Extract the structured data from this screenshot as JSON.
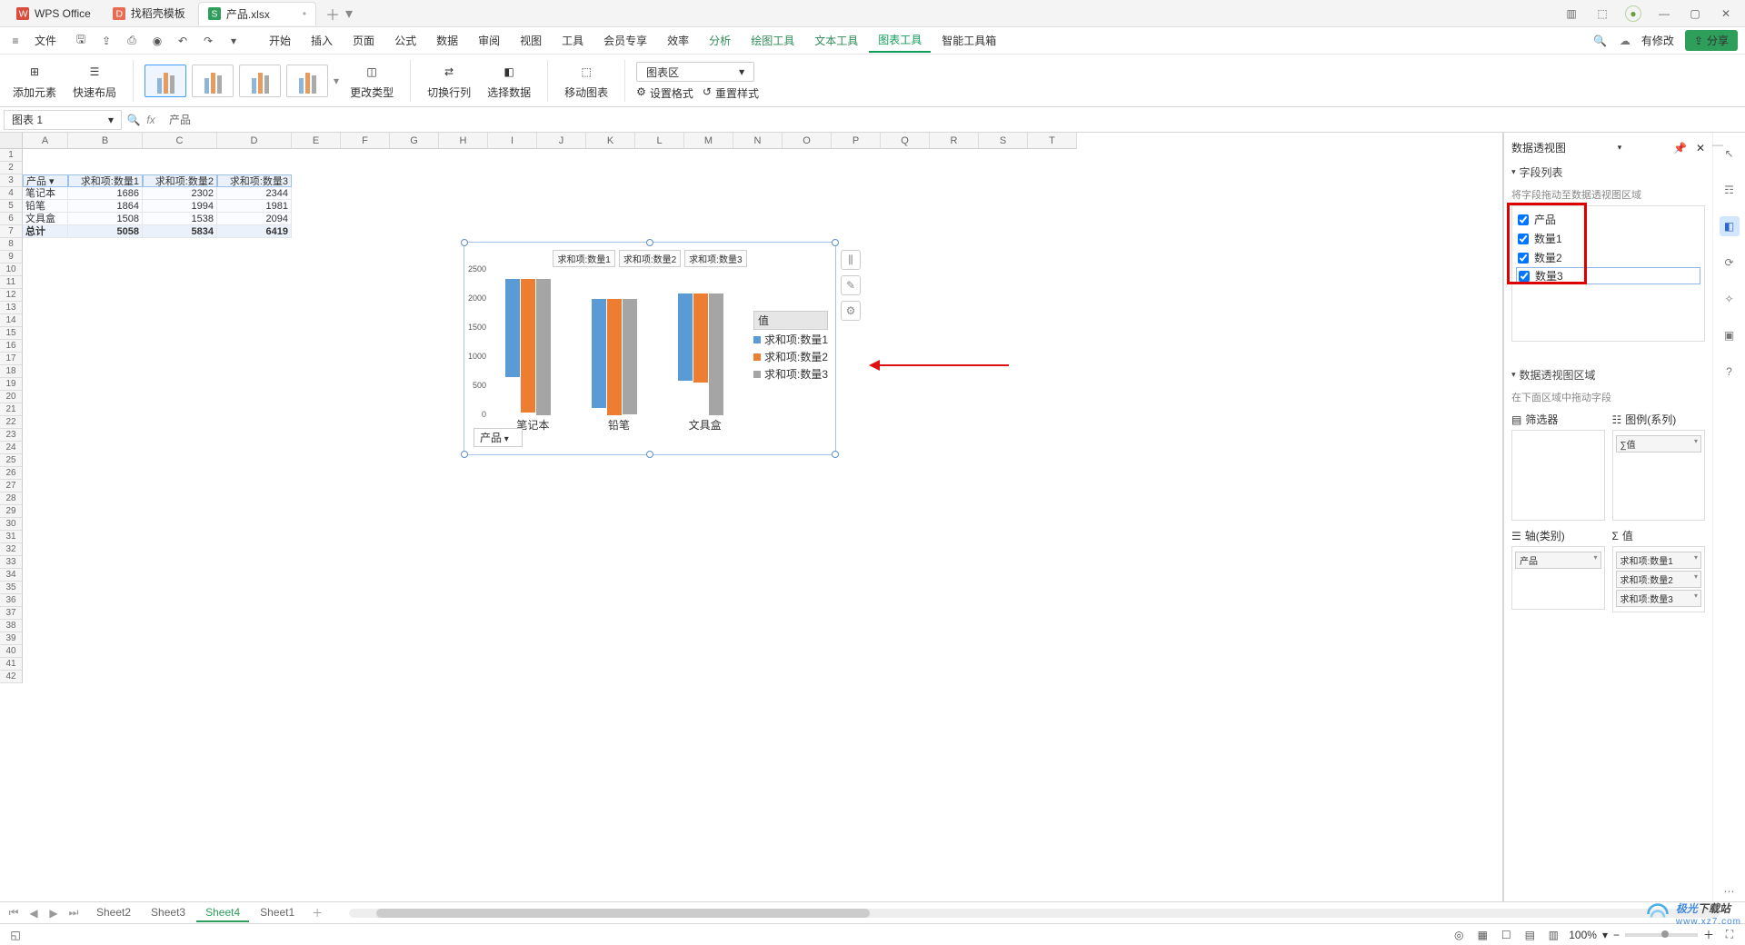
{
  "tabs": {
    "app": "WPS Office",
    "find": "找稻壳模板",
    "file": "产品.xlsx"
  },
  "menu": {
    "file": "文件",
    "items": [
      "开始",
      "插入",
      "页面",
      "公式",
      "数据",
      "审阅",
      "视图",
      "工具",
      "会员专享",
      "效率",
      "分析",
      "绘图工具",
      "文本工具",
      "图表工具",
      "智能工具箱"
    ],
    "has_changes": "有修改",
    "share": "分享"
  },
  "ribbon": {
    "add_elem": "添加元素",
    "quick_layout": "快速布局",
    "change_type": "更改类型",
    "switch_rc": "切换行列",
    "select_data": "选择数据",
    "move_chart": "移动图表",
    "set_format": "设置格式",
    "reset_style": "重置样式",
    "chart_area": "图表区"
  },
  "formula": {
    "name": "图表 1",
    "val": "产品"
  },
  "columns": [
    "A",
    "B",
    "C",
    "D",
    "E",
    "F",
    "G",
    "H",
    "I",
    "J",
    "K",
    "L",
    "M",
    "N",
    "O",
    "P",
    "Q",
    "R",
    "S",
    "T"
  ],
  "pivot": {
    "header": [
      "产品",
      "求和项:数量1",
      "求和项:数量2",
      "求和项:数量3"
    ],
    "rows": [
      [
        "笔记本",
        "1686",
        "2302",
        "2344"
      ],
      [
        "铅笔",
        "1864",
        "1994",
        "1981"
      ],
      [
        "文具盒",
        "1508",
        "1538",
        "2094"
      ],
      [
        "总计",
        "5058",
        "5834",
        "6419"
      ]
    ]
  },
  "chart_data": {
    "type": "bar",
    "categories": [
      "笔记本",
      "铅笔",
      "文具盒"
    ],
    "series": [
      {
        "name": "求和项:数量1",
        "values": [
          1686,
          1864,
          1508
        ]
      },
      {
        "name": "求和项:数量2",
        "values": [
          2302,
          1994,
          1538
        ]
      },
      {
        "name": "求和项:数量3",
        "values": [
          2344,
          1981,
          2094
        ]
      }
    ],
    "ylabel": "",
    "xlabel": "",
    "ylim": [
      0,
      2500
    ],
    "legend_top": [
      "求和项:数量1",
      "求和项:数量2",
      "求和项:数量3"
    ],
    "legend_right_title": "值",
    "filter_label": "产品"
  },
  "sidepane": {
    "title": "数据透视图",
    "section1": "字段列表",
    "hint": "将字段拖动至数据透视图区域",
    "fields": [
      "产品",
      "数量1",
      "数量2",
      "数量3"
    ],
    "section2": "数据透视图区域",
    "hint2": "在下面区域中拖动字段",
    "filter": "筛选器",
    "legend": "图例(系列)",
    "axis": "轴(类别)",
    "values": "值",
    "axis_items": [
      "产品"
    ],
    "legend_items": [
      "∑值"
    ],
    "value_items": [
      "求和项:数量1",
      "求和项:数量2",
      "求和项:数量3"
    ]
  },
  "sheets": [
    "Sheet2",
    "Sheet3",
    "Sheet4",
    "Sheet1"
  ],
  "sheets_current": 2,
  "status": {
    "zoom": "100%"
  },
  "watermark": {
    "brand_a": "极光",
    "brand_b": "下载站",
    "sub": "www.xz7.com"
  }
}
